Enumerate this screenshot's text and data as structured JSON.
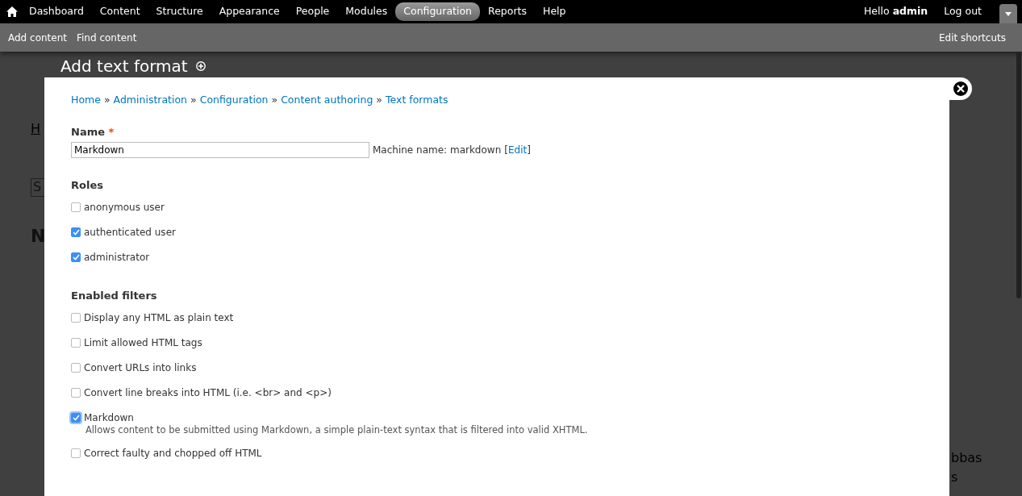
{
  "toolbar": {
    "menu": [
      {
        "label": "Dashboard",
        "selected": false
      },
      {
        "label": "Content",
        "selected": false
      },
      {
        "label": "Structure",
        "selected": false
      },
      {
        "label": "Appearance",
        "selected": false
      },
      {
        "label": "People",
        "selected": false
      },
      {
        "label": "Modules",
        "selected": false
      },
      {
        "label": "Configuration",
        "selected": true
      },
      {
        "label": "Reports",
        "selected": false
      },
      {
        "label": "Help",
        "selected": false
      }
    ],
    "greeting": "Hello **admin**",
    "logout": "Log out"
  },
  "shortcuts": {
    "items": [
      "Add content",
      "Find content"
    ],
    "edit": "Edit shortcuts"
  },
  "page_title": "Add text format",
  "background_page": {
    "breadcrumb_fragment": "H",
    "field_fragment": "S",
    "heading_fragment": "N",
    "text_fragments": [
      "bbas",
      "s"
    ]
  },
  "dialog": {
    "breadcrumb": [
      "Home",
      "Administration",
      "Configuration",
      "Content authoring",
      "Text formats"
    ],
    "breadcrumb_separator": "»",
    "name": {
      "label": "Name",
      "required_mark": "*",
      "value": "Markdown",
      "machine_name": "Machine name: markdown",
      "edit_open": "[",
      "edit_link": "Edit",
      "edit_close": "]"
    },
    "roles": {
      "heading": "Roles",
      "items": [
        {
          "label": "anonymous user",
          "checked": false
        },
        {
          "label": "authenticated user",
          "checked": true
        },
        {
          "label": "administrator",
          "checked": true
        }
      ]
    },
    "filters": {
      "heading": "Enabled filters",
      "items": [
        {
          "label": "Display any HTML as plain text",
          "checked": false
        },
        {
          "label": "Limit allowed HTML tags",
          "checked": false
        },
        {
          "label": "Convert URLs into links",
          "checked": false
        },
        {
          "label": "Convert line breaks into HTML (i.e. <br> and <p>)",
          "checked": false
        },
        {
          "label": "Markdown",
          "checked": true,
          "description": "Allows content to be submitted using Markdown, a simple plain-text syntax that is filtered into valid XHTML."
        },
        {
          "label": "Correct faulty and chopped off HTML",
          "checked": false
        }
      ]
    }
  }
}
